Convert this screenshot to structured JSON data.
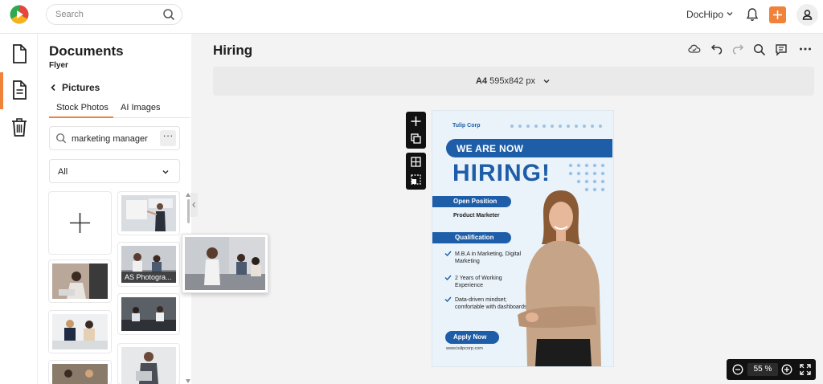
{
  "header": {
    "search_placeholder": "Search",
    "brand_name": "DocHipo",
    "icons": [
      "app-logo-icon",
      "search-icon",
      "chevron-down-icon",
      "bell-icon",
      "plus-icon",
      "user-icon"
    ],
    "accent_color": "#f0823a"
  },
  "rail": {
    "items": [
      "document-icon",
      "page-icon",
      "trash-icon"
    ],
    "active_index": 1
  },
  "panel": {
    "title": "Documents",
    "subtitle": "Flyer",
    "back_label": "Pictures",
    "tabs": [
      {
        "label": "Stock Photos",
        "active": true
      },
      {
        "label": "AI Images",
        "active": false
      }
    ],
    "search_value": "marketing manager",
    "more_label": "···",
    "filter_value": "All",
    "thumb_caption": "AS Photogra..."
  },
  "editor": {
    "doc_title": "Hiring",
    "size_format": "A4",
    "size_dims": "595x842 px",
    "toolbar_icons": [
      "cloud-icon",
      "undo-icon",
      "redo-icon",
      "search-icon",
      "comment-icon",
      "more-icon"
    ],
    "zoom_value": "55",
    "zoom_unit": "%"
  },
  "flyer": {
    "company": "Tulip Corp",
    "banner": "WE ARE NOW",
    "headline": "HIRING!",
    "open_position_label": "Open Position",
    "position": "Product Marketer",
    "qualification_label": "Qualification",
    "qualifications": [
      "M.B.A in Marketing, Digital Marketing",
      "2 Years of Working Experience",
      "Data-driven mindset; comfortable with dashboards"
    ],
    "cta": "Apply Now",
    "url": "www.tulipcorp.com",
    "brand_color": "#1e5ea8",
    "background_color": "#eaf3fa"
  }
}
